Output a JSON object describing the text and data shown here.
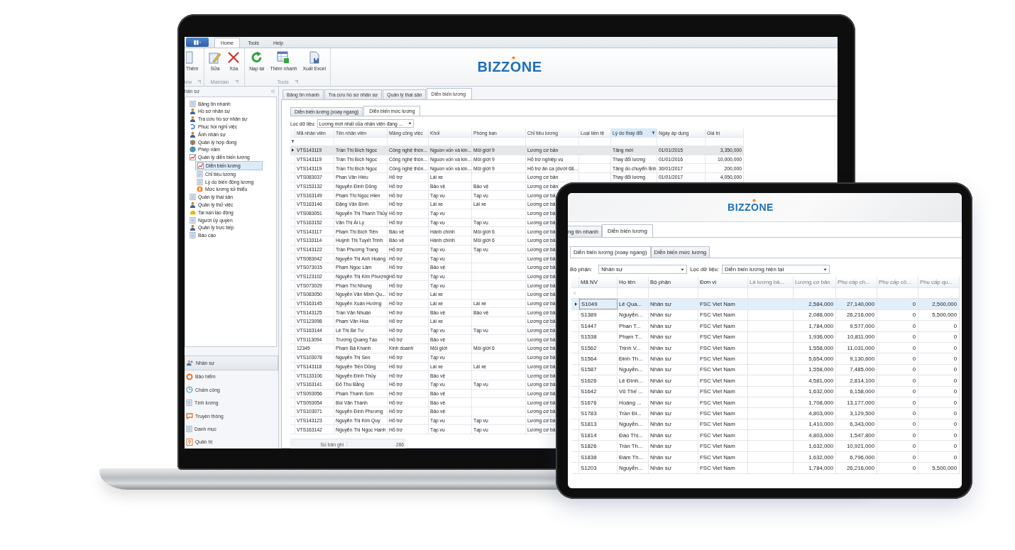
{
  "laptop": {
    "ribbon": {
      "tabs": [
        {
          "label": "Home",
          "selected": true
        },
        {
          "label": "Tools",
          "selected": false
        },
        {
          "label": "Help",
          "selected": false
        }
      ],
      "groups": [
        {
          "label": "iew",
          "buttons": [
            "Thêm"
          ]
        },
        {
          "label": "Maintain",
          "buttons": [
            "Sửa",
            "Xóa"
          ]
        },
        {
          "label": "Tools",
          "buttons": [
            "Nạp lại",
            "Thêm nhanh",
            "Xuất Excel"
          ]
        }
      ],
      "logo": "BIZZONE"
    },
    "sidebar": {
      "title": "hân sự",
      "tree": [
        {
          "label": "Bảng tin nhanh",
          "selected": false
        },
        {
          "label": "Hồ sơ nhân sự",
          "selected": false
        },
        {
          "label": "Tra cứu hồ sơ nhân sự",
          "selected": false
        },
        {
          "label": "Phục hồi nghỉ việc",
          "selected": false
        },
        {
          "label": "Ảnh nhân sự",
          "selected": false
        },
        {
          "label": "Quản lý hợp đồng",
          "selected": false
        },
        {
          "label": "Phép năm",
          "selected": false
        },
        {
          "label": "Quản lý diễn biến lương",
          "selected": false,
          "expanded": true,
          "children": [
            {
              "label": "Diễn biến lương",
              "selected": true
            },
            {
              "label": "Chỉ tiêu lương",
              "selected": false
            },
            {
              "label": "Lý do biến động lương",
              "selected": false
            },
            {
              "label": "Mức lương tối thiểu",
              "selected": false
            }
          ]
        },
        {
          "label": "Quản lý thai sản",
          "selected": false
        },
        {
          "label": "Quản lý thử việc",
          "selected": false
        },
        {
          "label": "Tai nạn lao động",
          "selected": false
        },
        {
          "label": "Người ủy quyền",
          "selected": false
        },
        {
          "label": "Quản lý trực tiếp",
          "selected": false
        },
        {
          "label": "Báo cáo",
          "selected": false
        }
      ],
      "nav": [
        {
          "label": "Nhân sự",
          "selected": true
        },
        {
          "label": "Bảo hiểm",
          "selected": false
        },
        {
          "label": "Chấm công",
          "selected": false
        },
        {
          "label": "Tính lương",
          "selected": false
        },
        {
          "label": "Truyền thông",
          "selected": false
        },
        {
          "label": "Danh mục",
          "selected": false
        },
        {
          "label": "Quản trị",
          "selected": false
        }
      ]
    },
    "doc_tabs": [
      {
        "label": "Bảng tin nhanh",
        "selected": false
      },
      {
        "label": "Tra cứu hồ sơ nhân sự",
        "selected": false
      },
      {
        "label": "Quản lý thai sản",
        "selected": false
      },
      {
        "label": "Diễn biến lương",
        "selected": true
      }
    ],
    "sub_tabs": [
      {
        "label": "Diễn biến lương (xoay ngang)",
        "selected": false
      },
      {
        "label": "Diễn biến mức lương",
        "selected": true
      }
    ],
    "filter": {
      "label": "Lọc dữ liệu:",
      "value": "Lương mới nhất của nhân viên đang ..."
    },
    "table": {
      "columns": [
        {
          "label": "Mã nhân viên",
          "filtered": false
        },
        {
          "label": "Tên nhân viên",
          "filtered": false
        },
        {
          "label": "Mảng công việc",
          "filtered": false
        },
        {
          "label": "Khối",
          "filtered": false
        },
        {
          "label": "Phòng ban",
          "filtered": false
        },
        {
          "label": "Chỉ tiêu lương",
          "filtered": false
        },
        {
          "label": "Loại tiền tệ",
          "filtered": false
        },
        {
          "label": "Lý do thay đổi",
          "filtered": true
        },
        {
          "label": "Ngày áp dụng",
          "filtered": false
        },
        {
          "label": "Giá trị",
          "filtered": false
        }
      ],
      "rows": [
        {
          "selected": true,
          "cells": [
            "VTS143119",
            "Trần Thị Bích Ngọc",
            "Công nghệ thôn...",
            "Nguồn vốn và kin...",
            "Môi giới 9",
            "Lương cơ bản",
            null,
            "Tăng mới",
            "01/01/2015",
            "3,350,000"
          ]
        },
        {
          "selected": false,
          "cells": [
            "VTS143119",
            "Trần Thị Bích Ngọc",
            "Công nghệ thôn...",
            "Nguồn vốn và kin...",
            "Môi giới 9",
            "Hỗ trợ nghiệp vụ",
            null,
            "Thay đổi lương",
            "01/01/2016",
            "10,000,000"
          ]
        },
        {
          "selected": false,
          "cells": [
            "VTS143119",
            "Trần Thị Bích Ngọc",
            "Công nghệ thôn...",
            "Nguồn vốn và kin...",
            "Môi giới 9",
            "Hỗ trợ ăn ca (dưới 68...",
            null,
            "Tăng do chuyển tỉnh",
            "30/01/2017",
            "200,000"
          ]
        },
        {
          "selected": false,
          "cells": [
            "VTS083037",
            "Phan Văn Hiếu",
            "Hỗ trợ",
            "Lái xe",
            null,
            "Lương cơ bản",
            null,
            "Thay đổi lương",
            "01/01/2017",
            "4,050,000"
          ]
        },
        {
          "selected": false,
          "cells": [
            "VTS153132",
            "Nguyễn Đình Dũng",
            "Hỗ trợ",
            "Bảo vệ",
            "Bảo vệ",
            "Lương cơ bản"
          ]
        },
        {
          "selected": false,
          "cells": [
            "VTS163149",
            "Phạm Thị Ngọc Hiền",
            "Hỗ trợ",
            "Tạp vụ",
            "Tạp vụ",
            "Lương cơ bả"
          ]
        },
        {
          "selected": false,
          "cells": [
            "VTS163146",
            "Đặng Văn Bình",
            "Hỗ trợ",
            "Lái xe",
            "Lái xe",
            "Lương cơ bả"
          ]
        },
        {
          "selected": false,
          "cells": [
            "VTS083051",
            "Nguyễn Thị Thanh Thủy",
            "Hỗ trợ",
            "Tạp vụ",
            null,
            "Lương cơ bả"
          ]
        },
        {
          "selected": false,
          "cells": [
            "VTS163152",
            "Văn Thị Ái Ly",
            "Hỗ trợ",
            "Tạp vụ",
            "Tạp vụ",
            "Lương cơ bả"
          ]
        },
        {
          "selected": false,
          "cells": [
            "VTS143117",
            "Phạm Thị Bích Tiên",
            "Bảo vệ",
            "Hành chính",
            "Môi giới 6",
            "Lương cơ bả"
          ]
        },
        {
          "selected": false,
          "cells": [
            "VTS133114",
            "Huỳnh Thị Tuyết Trinh",
            "Bảo vệ",
            "Hành chính",
            "Môi giới 6",
            "Lương cơ bả"
          ]
        },
        {
          "selected": false,
          "cells": [
            "VTS143122",
            "Trần Phương Trang",
            "Hỗ trợ",
            "Tạp vụ",
            "Tạp vụ",
            "Lương cơ bả"
          ]
        },
        {
          "selected": false,
          "cells": [
            "VTS083042",
            "Nguyễn Thị Anh Hoàng",
            "Hỗ trợ",
            "Tạp vụ",
            null,
            "Lương cơ bả"
          ]
        },
        {
          "selected": false,
          "cells": [
            "VTS073015",
            "Phạm Ngọc Lâm",
            "Hỗ trợ",
            "Bảo vệ",
            null,
            "Lương cơ bả"
          ]
        },
        {
          "selected": false,
          "cells": [
            "VTS123102",
            "Nguyễn Thị Kim Phượng",
            "Hỗ trợ",
            "Tạp vụ",
            null,
            "Lương cơ bả"
          ]
        },
        {
          "selected": false,
          "cells": [
            "VTS073029",
            "Phạm Thị Nhung",
            "Hỗ trợ",
            "Tạp vụ",
            null,
            "Lương cơ bả"
          ]
        },
        {
          "selected": false,
          "cells": [
            "VTS083050",
            "Nguyễn Văn Minh Qu...",
            "Hỗ trợ",
            "Lái xe",
            null,
            "Lương cơ bả"
          ]
        },
        {
          "selected": false,
          "cells": [
            "VTS163145",
            "Nguyễn Xuân Hướng",
            "Hỗ trợ",
            "Lái xe",
            "Lái xe",
            "Lương cơ bả"
          ]
        },
        {
          "selected": false,
          "cells": [
            "VTS143125",
            "Trần Văn Nhuận",
            "Hỗ trợ",
            "Bảo vệ",
            "Bảo vệ",
            "Lương cơ bả"
          ]
        },
        {
          "selected": false,
          "cells": [
            "VTS123098",
            "Phạm Văn Hòa",
            "Hỗ trợ",
            "Lái xe",
            null,
            "Lương cơ bả"
          ]
        },
        {
          "selected": false,
          "cells": [
            "VTS163144",
            "Lê Thị Bé Tư",
            "Hỗ trợ",
            "Tạp vụ",
            "Tạp vụ",
            "Lương cơ bả"
          ]
        },
        {
          "selected": false,
          "cells": [
            "VTS113094",
            "Trương Quang Tạo",
            "Hỗ trợ",
            "Bảo vệ",
            null,
            "Lương cơ bả"
          ]
        },
        {
          "selected": false,
          "cells": [
            "12345",
            "Phạm Bá Khanh",
            "Kinh doanh",
            "Môi giới",
            "Môi giới 6",
            "Lương cơ bả"
          ]
        },
        {
          "selected": false,
          "cells": [
            "VTS103078",
            "Nguyễn Thị Sen",
            "Hỗ trợ",
            "Tạp vụ",
            null,
            "Lương cơ bả"
          ]
        },
        {
          "selected": false,
          "cells": [
            "VTS143118",
            "Nguyễn Tiến Dũng",
            "Hỗ trợ",
            "Lái xe",
            "Lái xe",
            "Lương cơ bả"
          ]
        },
        {
          "selected": false,
          "cells": [
            "VTS133106",
            "Nguyễn Đình Thủy",
            "Hỗ trợ",
            "Bảo vệ",
            null,
            "Lương cơ bả"
          ]
        },
        {
          "selected": false,
          "cells": [
            "VTS163141",
            "Đỗ Thu Bằng",
            "Hỗ trợ",
            "Tạp vụ",
            "Tạp vụ",
            "Lương cơ bả"
          ]
        },
        {
          "selected": false,
          "cells": [
            "VTS093056",
            "Phạm Thanh Sơn",
            "Hỗ trợ",
            "Bảo vệ",
            null,
            "Lương cơ bả"
          ]
        },
        {
          "selected": false,
          "cells": [
            "VTS093054",
            "Bùi Văn Thành",
            "Hỗ trợ",
            "Bảo vệ",
            null,
            "Lương cơ bả"
          ]
        },
        {
          "selected": false,
          "cells": [
            "VTS103071",
            "Nguyễn Đình Phương",
            "Hỗ trợ",
            "Bảo vệ",
            null,
            "Lương cơ bả"
          ]
        },
        {
          "selected": false,
          "cells": [
            "VTS143123",
            "Nguyễn Thị Kim Quy",
            "Hỗ trợ",
            "Tạp vụ",
            "Tạp vụ",
            "Lương cơ bả"
          ]
        },
        {
          "selected": false,
          "cells": [
            "VTS163142",
            "Nguyễn Thị Ngọc Hạnh",
            "Hỗ trợ",
            "Tạp vụ",
            "Tạp vụ",
            "Lương cơ bả"
          ]
        }
      ],
      "footer": {
        "label": "Số bản ghi",
        "count": "286"
      }
    }
  },
  "tablet": {
    "logo": "BIZZONE",
    "doc_tabs": [
      {
        "label": "ng tin nhanh",
        "selected": false
      },
      {
        "label": "Diễn biến lương",
        "selected": true
      }
    ],
    "sub_tabs": [
      {
        "label": "Diễn biến lương (xoay ngang)",
        "selected": true
      },
      {
        "label": "Diễn biến mức lương",
        "selected": false
      }
    ],
    "filters": [
      {
        "label": "Bộ phận:",
        "value": "Nhân sự"
      },
      {
        "label": "Lọc dữ liệu:",
        "value": "Diễn biến lương hiện tại"
      }
    ],
    "table": {
      "columns": [
        "Mã NV",
        "Họ tên",
        "Bộ phận",
        "Đơn vị",
        "Là lương bả...",
        "Lương cơ bản",
        "Phụ cấp ch...",
        "Phụ cấp cô...",
        "Phụ cấp qu..."
      ],
      "rows": [
        {
          "selected": true,
          "cells": [
            "S1049",
            "Lê Qua...",
            "Nhân sự",
            "FSC Viet Nam",
            null,
            "2,584,000",
            "27,140,000",
            "0",
            "2,500,000"
          ]
        },
        {
          "selected": false,
          "cells": [
            "S1389",
            "Nguyễn...",
            "Nhân sự",
            "FSC Viet Nam",
            null,
            "2,088,000",
            "26,216,000",
            "0",
            "5,500,000"
          ]
        },
        {
          "selected": false,
          "cells": [
            "S1447",
            "Phan T...",
            "Nhân sự",
            "FSC Viet Nam",
            null,
            "1,784,000",
            "9,577,000",
            "0",
            "0"
          ]
        },
        {
          "selected": false,
          "cells": [
            "S1538",
            "Phạm T...",
            "Nhân sự",
            "FSC Viet Nam",
            null,
            "1,936,000",
            "10,811,000",
            "0",
            "0"
          ]
        },
        {
          "selected": false,
          "cells": [
            "S1562",
            "Trịnh V...",
            "Nhân sự",
            "FSC Viet Nam",
            null,
            "1,558,000",
            "11,031,000",
            "0",
            "0"
          ]
        },
        {
          "selected": false,
          "cells": [
            "S1564",
            "Đinh Th...",
            "Nhân sự",
            "FSC Viet Nam",
            null,
            "5,654,000",
            "9,130,600",
            "0",
            "0"
          ]
        },
        {
          "selected": false,
          "cells": [
            "S1587",
            "Nguyễn...",
            "Nhân sự",
            "FSC Viet Nam",
            null,
            "1,558,000",
            "7,485,000",
            "0",
            "0"
          ]
        },
        {
          "selected": false,
          "cells": [
            "S1626",
            "Lê Đình...",
            "Nhân sự",
            "FSC Viet Nam",
            null,
            "4,581,000",
            "2,814,100",
            "0",
            "0"
          ]
        },
        {
          "selected": false,
          "cells": [
            "S1642",
            "Vũ Thế ...",
            "Nhân sự",
            "FSC Viet Nam",
            null,
            "1,632,000",
            "6,158,000",
            "0",
            "0"
          ]
        },
        {
          "selected": false,
          "cells": [
            "S1676",
            "Hoàng ...",
            "Nhân sự",
            "FSC Viet Nam",
            null,
            "1,708,000",
            "13,177,000",
            "0",
            "0"
          ]
        },
        {
          "selected": false,
          "cells": [
            "S1783",
            "Trần Đi...",
            "Nhân sự",
            "FSC Viet Nam",
            null,
            "4,803,000",
            "3,129,500",
            "0",
            "0"
          ]
        },
        {
          "selected": false,
          "cells": [
            "S1813",
            "Nguyễn...",
            "Nhân sự",
            "FSC Viet Nam",
            null,
            "1,410,000",
            "6,343,000",
            "0",
            "0"
          ]
        },
        {
          "selected": false,
          "cells": [
            "S1814",
            "Đào Thị...",
            "Nhân sự",
            "FSC Viet Nam",
            null,
            "4,803,000",
            "1,547,800",
            "0",
            "0"
          ]
        },
        {
          "selected": false,
          "cells": [
            "S1826",
            "Trần Th...",
            "Nhân sự",
            "FSC Viet Nam",
            null,
            "1,632,000",
            "10,921,000",
            "0",
            "0"
          ]
        },
        {
          "selected": false,
          "cells": [
            "S1838",
            "Đàm Th...",
            "Nhân sự",
            "FSC Viet Nam",
            null,
            "1,632,000",
            "6,796,000",
            "0",
            "0"
          ]
        },
        {
          "selected": false,
          "cells": [
            "S1203",
            "Nguyễn...",
            "Nhân sự",
            "FSC Viet Nam",
            null,
            "1,784,000",
            "26,216,000",
            "0",
            "5,500,000"
          ]
        }
      ]
    }
  }
}
